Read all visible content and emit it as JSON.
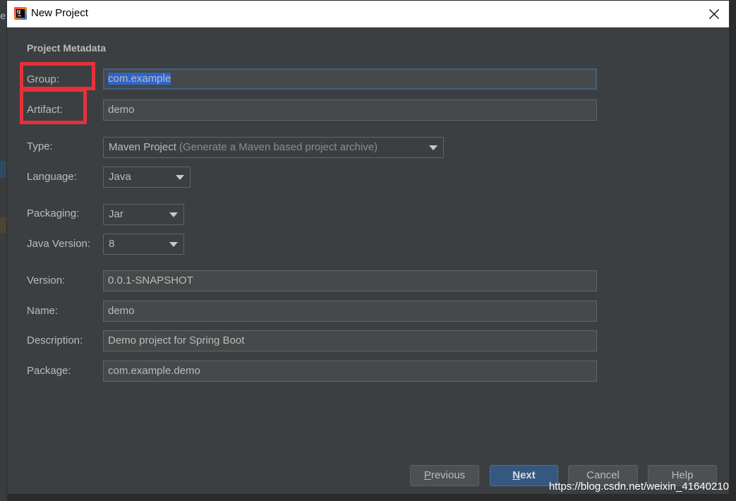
{
  "window": {
    "title": "New Project"
  },
  "section_title": "Project Metadata",
  "fields": {
    "group": {
      "label": "Group:",
      "value": "com.example"
    },
    "artifact": {
      "label": "Artifact:",
      "value": "demo"
    },
    "type": {
      "label": "Type:",
      "value": "Maven Project",
      "hint": "(Generate a Maven based project archive)"
    },
    "language": {
      "label": "Language:",
      "value": "Java"
    },
    "packaging": {
      "label": "Packaging:",
      "value": "Jar"
    },
    "java_version": {
      "label": "Java Version:",
      "value": "8"
    },
    "version": {
      "label": "Version:",
      "value": "0.0.1-SNAPSHOT"
    },
    "name": {
      "label": "Name:",
      "value": "demo"
    },
    "description": {
      "label": "Description:",
      "value": "Demo project for Spring Boot"
    },
    "package": {
      "label": "Package:",
      "value": "com.example.demo"
    }
  },
  "buttons": {
    "previous": {
      "mnemonic": "P",
      "rest": "revious"
    },
    "next": {
      "mnemonic": "N",
      "rest": "ext"
    },
    "cancel": "Cancel",
    "help": "Help"
  },
  "background_text": "e",
  "watermark": "https://blog.csdn.net/weixin_41640210",
  "colors": {
    "dialog_bg": "#3c3f41",
    "field_bg": "#45494a",
    "text": "#bbbbbb",
    "default_button": "#365880",
    "annotation_red": "#e8303a",
    "selection": "#2f65ca"
  },
  "icons": [
    "intellij-app-icon",
    "close-icon",
    "dropdown-arrow-icon"
  ]
}
